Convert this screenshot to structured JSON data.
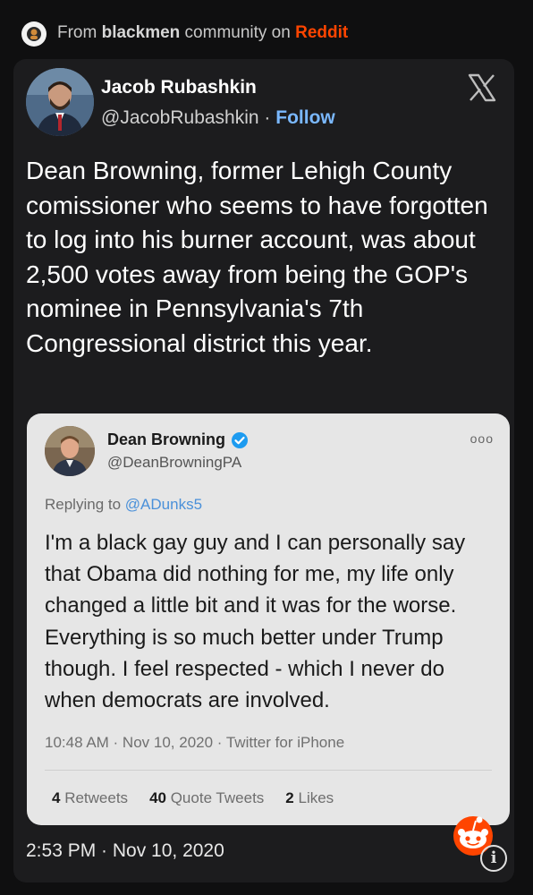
{
  "source": {
    "prefix": "From ",
    "community": "blackmen",
    "middle": " community on ",
    "platform": "Reddit"
  },
  "author": {
    "name": "Jacob Rubashkin",
    "handle": "@JacobRubashkin",
    "separator": " · ",
    "follow_label": "Follow"
  },
  "tweet": {
    "text": "Dean Browning, former Lehigh County comissioner who seems to have forgotten to log into his burner account, was about 2,500 votes away from being the GOP's nominee in Pennsylvania's 7th Congressional district this year.",
    "timestamp": "2:53 PM · Nov 10, 2020"
  },
  "quoted": {
    "name": "Dean Browning",
    "handle": "@DeanBrowningPA",
    "more": "ooo",
    "replying_prefix": "Replying to ",
    "replying_to": "@ADunks5",
    "text": "I'm a black gay guy and I can personally say that Obama did nothing for me, my life only changed a little bit and it was for the worse. Everything is so much better under Trump though. I feel respected - which I never do when democrats are involved.",
    "meta": "10:48 AM · Nov 10, 2020 · Twitter for iPhone",
    "retweets_count": "4",
    "retweets_label": " Retweets",
    "quotes_count": "40",
    "quotes_label": " Quote Tweets",
    "likes_count": "2",
    "likes_label": " Likes"
  },
  "icons": {
    "community": "community-avatar-icon",
    "x_logo": "x-logo-icon",
    "verified": "verified-badge-icon",
    "reddit": "reddit-snoo-icon",
    "info": "info-icon"
  },
  "colors": {
    "background": "#0f0f10",
    "card": "#1c1c1e",
    "quote_card": "#e6e6e6",
    "reddit": "#ff4500",
    "follow": "#7ab8ff",
    "verified": "#1d9bf0"
  }
}
